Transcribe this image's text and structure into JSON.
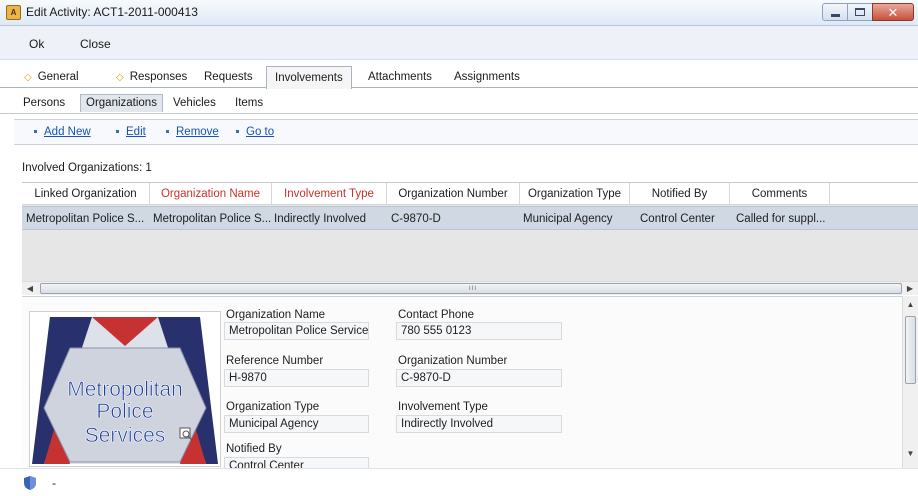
{
  "window": {
    "title": "Edit Activity: ACT1-2011-000413",
    "app_icon_text": "A"
  },
  "menu": {
    "ok": "Ok",
    "close": "Close"
  },
  "tabs": [
    {
      "label": "General",
      "marked": true
    },
    {
      "label": "Responses",
      "marked": true
    },
    {
      "label": "Requests",
      "marked": false
    },
    {
      "label": "Involvements",
      "marked": false,
      "active": true
    },
    {
      "label": "Attachments",
      "marked": false
    },
    {
      "label": "Assignments",
      "marked": false
    }
  ],
  "subtabs": [
    {
      "label": "Persons"
    },
    {
      "label": "Organizations",
      "active": true
    },
    {
      "label": "Vehicles"
    },
    {
      "label": "Items"
    }
  ],
  "actions": {
    "add_new": "Add New",
    "edit": "Edit",
    "remove": "Remove",
    "go_to": "Go to"
  },
  "involved_count_label": "Involved Organizations: 1",
  "grid": {
    "columns": [
      "Linked Organization",
      "Organization Name",
      "Involvement Type",
      "Organization Number",
      "Organization Type",
      "Notified By",
      "Comments"
    ],
    "highlighted_columns": [
      "Organization Name",
      "Involvement Type"
    ],
    "rows": [
      [
        "Metropolitan Police S...",
        "Metropolitan Police S...",
        "Indirectly Involved",
        "C-9870-D",
        "Municipal Agency",
        "Control Center",
        "Called for suppl..."
      ]
    ],
    "scroll_grip": "III"
  },
  "logo": {
    "line1": "Metropolitan",
    "line2": "Police",
    "line3": "Services"
  },
  "details": {
    "organization_name_label": "Organization Name",
    "organization_name_value": "Metropolitan Police Service",
    "contact_phone_label": "Contact Phone",
    "contact_phone_value": "780 555 0123",
    "reference_number_label": "Reference Number",
    "reference_number_value": "H-9870",
    "organization_number_label": "Organization Number",
    "organization_number_value": "C-9870-D",
    "organization_type_label": "Organization Type",
    "organization_type_value": "Municipal Agency",
    "involvement_type_label": "Involvement Type",
    "involvement_type_value": "Indirectly Involved",
    "notified_by_label": "Notified By",
    "notified_by_value": "Control Center"
  },
  "status": {
    "text": "-"
  },
  "colors": {
    "accent_link": "#1553b8",
    "required_header": "#c8322b",
    "tab_marker": "#e39a1d",
    "selected_row": "#cfd8e3"
  }
}
